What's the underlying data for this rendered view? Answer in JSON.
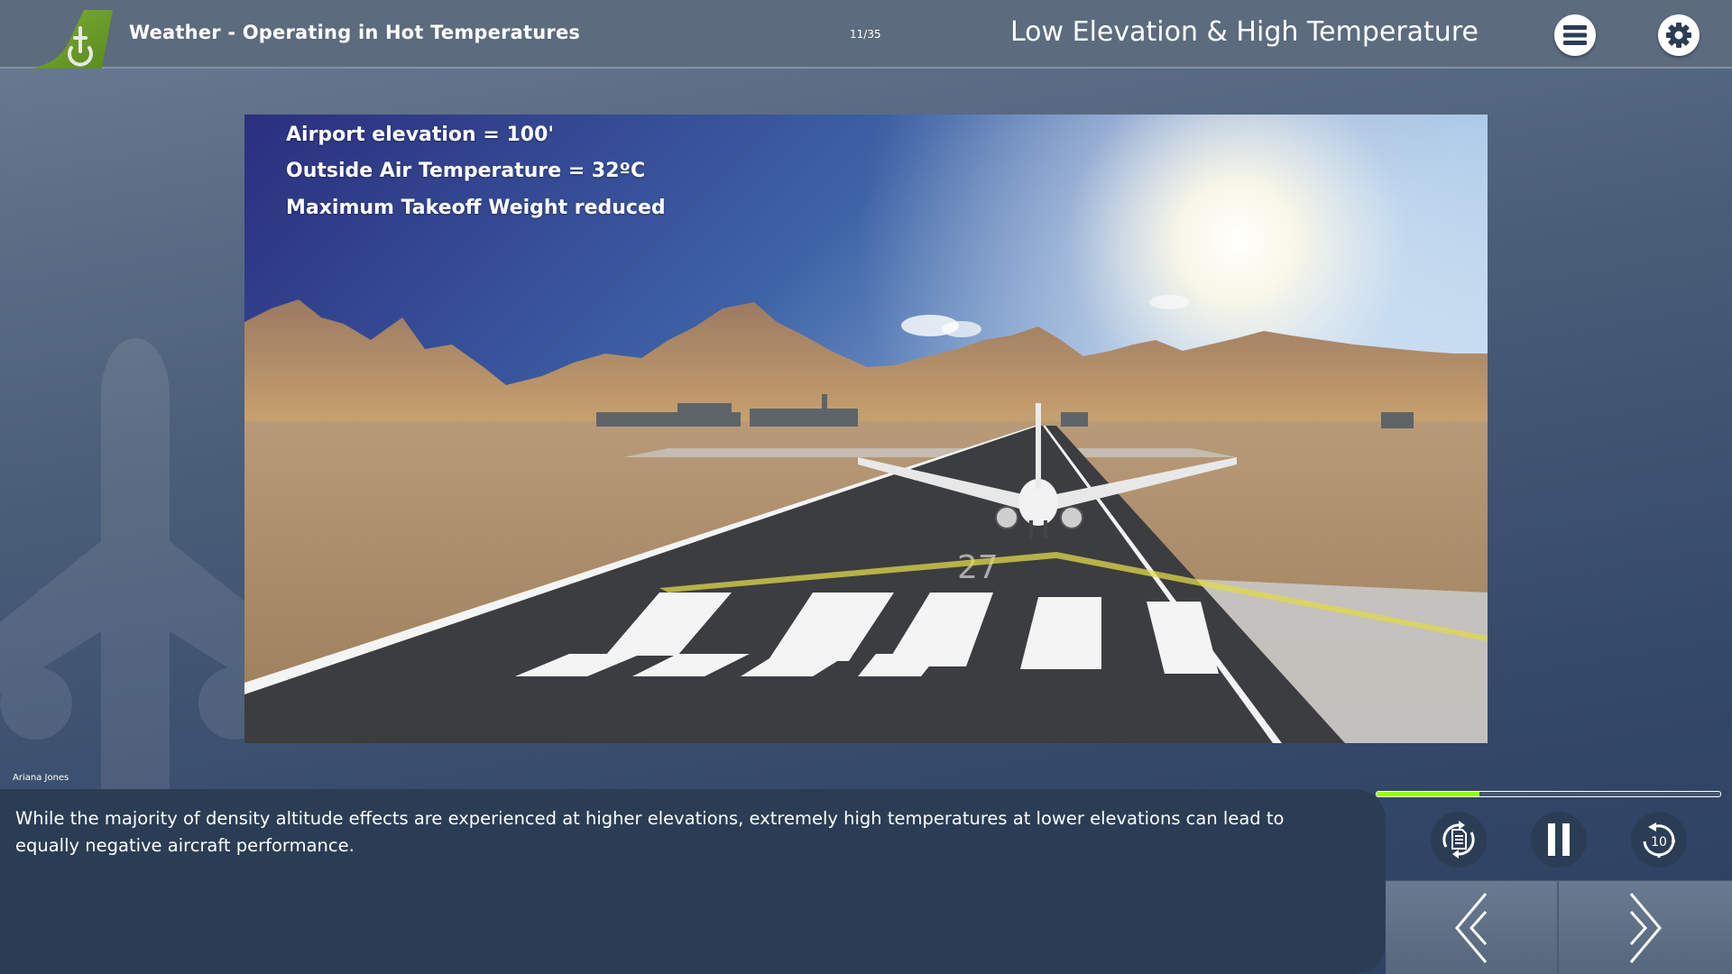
{
  "header": {
    "course_title": "Weather - Operating in Hot Temperatures",
    "page_counter": "11/35",
    "slide_title": "Low Elevation & High Temperature",
    "logo": "tail-fin-logo",
    "menu_icon": "hamburger-menu-icon",
    "settings_icon": "gear-icon"
  },
  "scene": {
    "description": "Airliner on desert runway 27 with mountains and bright sun",
    "runway_number": "27",
    "lines": [
      "Airport elevation = 100'",
      "Outside Air Temperature = 32ºC",
      "Maximum Takeoff Weight reduced"
    ]
  },
  "transcript": {
    "speaker": "Ariana Jones",
    "text": "While the majority of density altitude effects are experienced at higher elevations, extremely high temperatures at lower elevations can lead to equally negative aircraft performance."
  },
  "controls": {
    "progress_fraction": 0.3,
    "progress_color": "#99ff00",
    "buttons": [
      {
        "name": "transcript-toggle",
        "icon": "document-refresh-icon"
      },
      {
        "name": "pause",
        "icon": "pause-icon"
      },
      {
        "name": "rewind-10",
        "icon": "rewind-10-icon",
        "label": "10"
      }
    ],
    "prev_icon": "double-chevron-left-icon",
    "next_icon": "chevron-right-icon"
  },
  "colors": {
    "header_bg": "#5c6b7e",
    "panel_bg": "#2b3d55",
    "logo_green": "#6b9a28"
  }
}
